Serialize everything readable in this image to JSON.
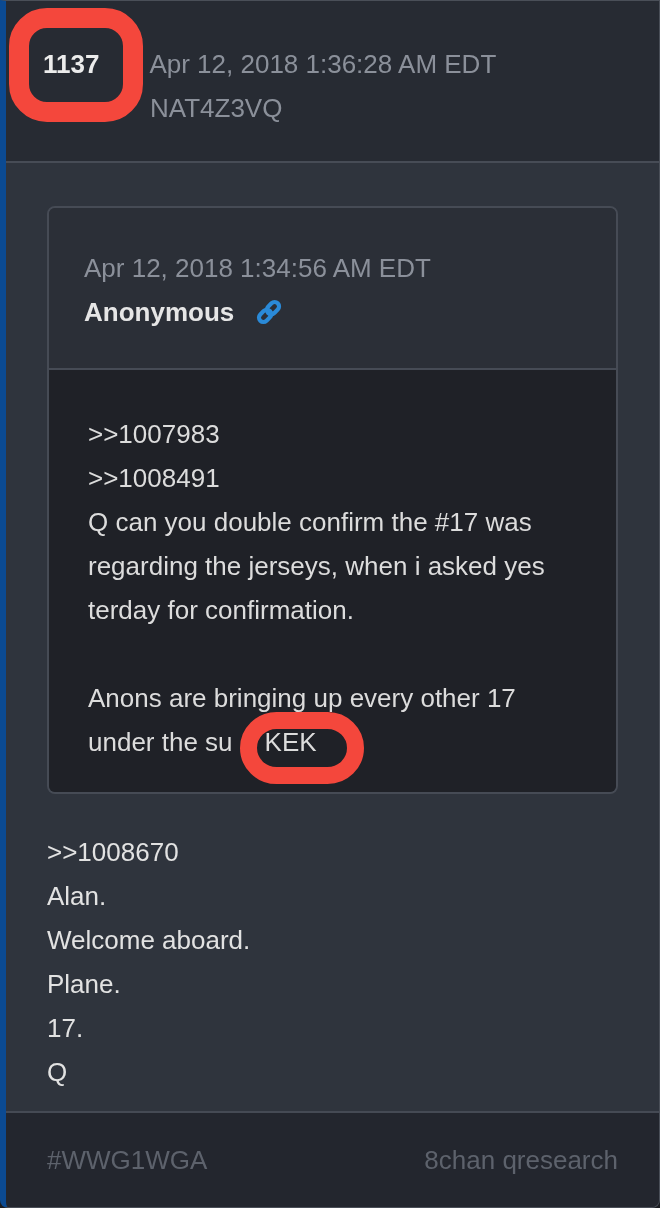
{
  "post": {
    "number": "1137",
    "number_circled": true,
    "timestamp": "Apr 12, 2018 1:36:28 AM EDT",
    "user_id": "NAT4Z3VQ"
  },
  "quoted_post": {
    "timestamp": "Apr 12, 2018 1:34:56 AM EDT",
    "author": "Anonymous",
    "paragraphs": [
      [
        [
          {
            "text": ">>1007983",
            "circled": false
          }
        ],
        [
          {
            "text": ">>1008491",
            "circled": false
          }
        ],
        [
          {
            "text": "Q can you double confirm the #17 was",
            "circled": false
          }
        ],
        [
          {
            "text": "regarding the jerseys, when i asked yes",
            "circled": false
          }
        ],
        [
          {
            "text": "terday for confirmation.",
            "circled": false
          }
        ]
      ],
      [
        [
          {
            "text": "Anons are bringing up every other 17",
            "circled": false
          }
        ],
        [
          {
            "text": "under the su",
            "circled": false
          },
          {
            "text": "KEK",
            "circled": true
          }
        ]
      ]
    ]
  },
  "message_lines": [
    ">>1008670",
    "Alan.",
    "Welcome aboard.",
    "Plane.",
    "17.",
    "Q"
  ],
  "footer": {
    "hashtag": "#WWG1WGA",
    "source": "8chan qresearch"
  }
}
